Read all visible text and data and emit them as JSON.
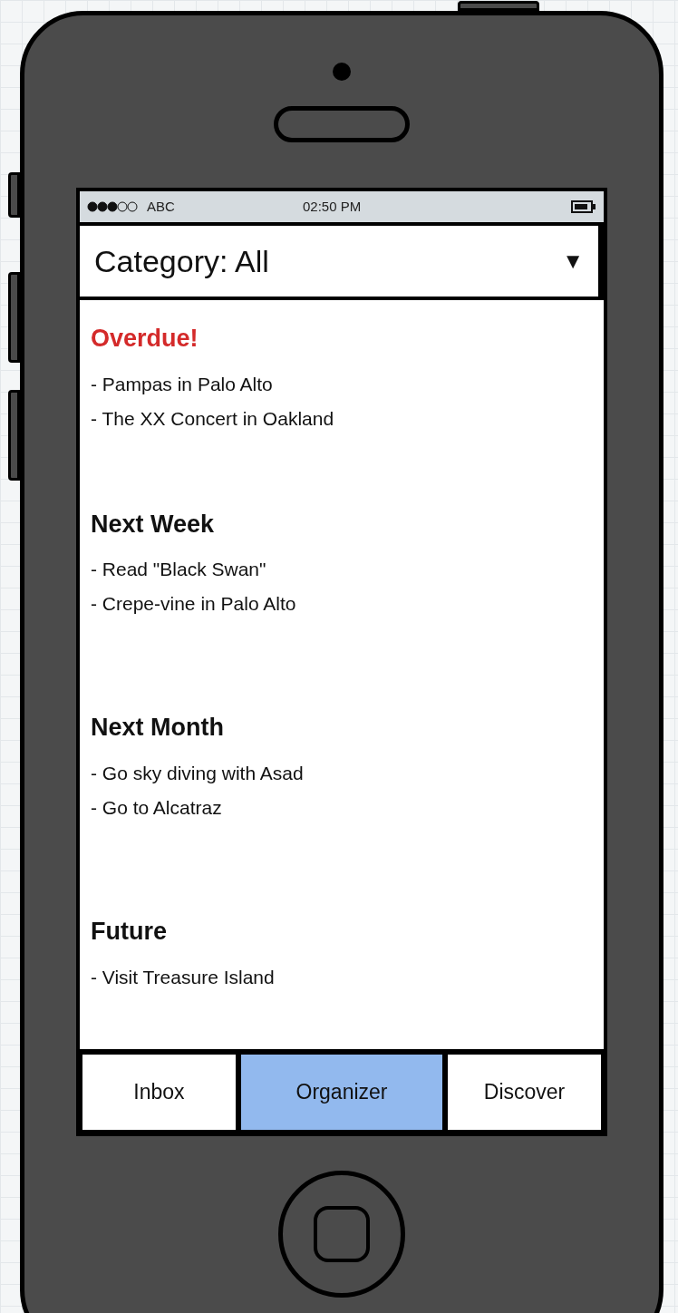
{
  "status_bar": {
    "carrier": "ABC",
    "time": "02:50 PM"
  },
  "category_dropdown": {
    "value": "Category: All",
    "caret": "▼"
  },
  "sections": [
    {
      "title": "Overdue!",
      "color": "#d42a2a",
      "items": [
        "- Pampas in Palo Alto",
        "- The XX Concert in Oakland"
      ]
    },
    {
      "title": "Next Week",
      "color": "#111111",
      "items": [
        "- Read \"Black Swan\"",
        "- Crepe-vine in Palo Alto"
      ]
    },
    {
      "title": "Next Month",
      "color": "#111111",
      "items": [
        "- Go sky diving with Asad",
        "- Go to Alcatraz"
      ]
    },
    {
      "title": "Future",
      "color": "#111111",
      "items": [
        "- Visit Treasure Island"
      ]
    }
  ],
  "tabs": [
    {
      "label": "Inbox",
      "selected": false
    },
    {
      "label": "Organizer",
      "selected": true
    },
    {
      "label": "Discover",
      "selected": false
    }
  ]
}
